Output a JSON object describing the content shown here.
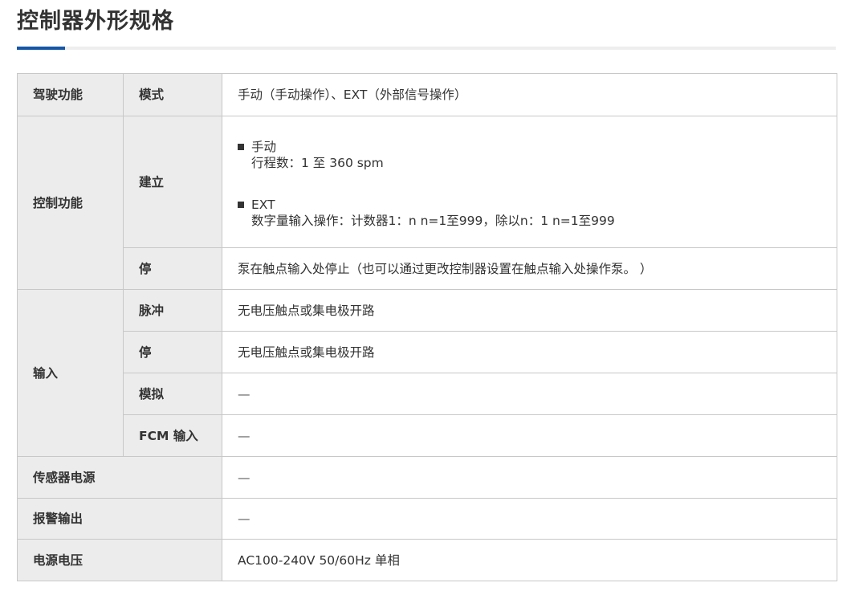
{
  "page": {
    "title": "控制器外形规格"
  },
  "rows": {
    "drive": {
      "label": "驾驶功能",
      "sub": "模式",
      "value": "手动（手动操作）、EXT（外部信号操作）"
    },
    "control": {
      "label": "控制功能",
      "build": {
        "sub": "建立",
        "manual_title": "手动",
        "manual_detail": "行程数：1 至 360 spm",
        "ext_title": "EXT",
        "ext_detail": "数字量输入操作：计数器1：n n=1至999，除以n：1 n=1至999"
      },
      "stop": {
        "sub": "停",
        "value": "泵在触点输入处停止（也可以通过更改控制器设置在触点输入处操作泵。 ）"
      }
    },
    "input": {
      "label": "输入",
      "pulse": {
        "sub": "脉冲",
        "value": "无电压触点或集电极开路"
      },
      "stop": {
        "sub": "停",
        "value": "无电压触点或集电极开路"
      },
      "analog": {
        "sub": "模拟",
        "value": "—"
      },
      "fcm": {
        "sub": "FCM 输入",
        "value": "—"
      }
    },
    "sensor_power": {
      "label": "传感器电源",
      "value": "—"
    },
    "alarm_output": {
      "label": "报警输出",
      "value": "—"
    },
    "power_voltage": {
      "label": "电源电压",
      "value": "AC100-240V 50/60Hz 单相"
    }
  },
  "colors": {
    "accent": "#1556a6",
    "header_bg": "#ececec",
    "border": "#c8c8c8"
  }
}
